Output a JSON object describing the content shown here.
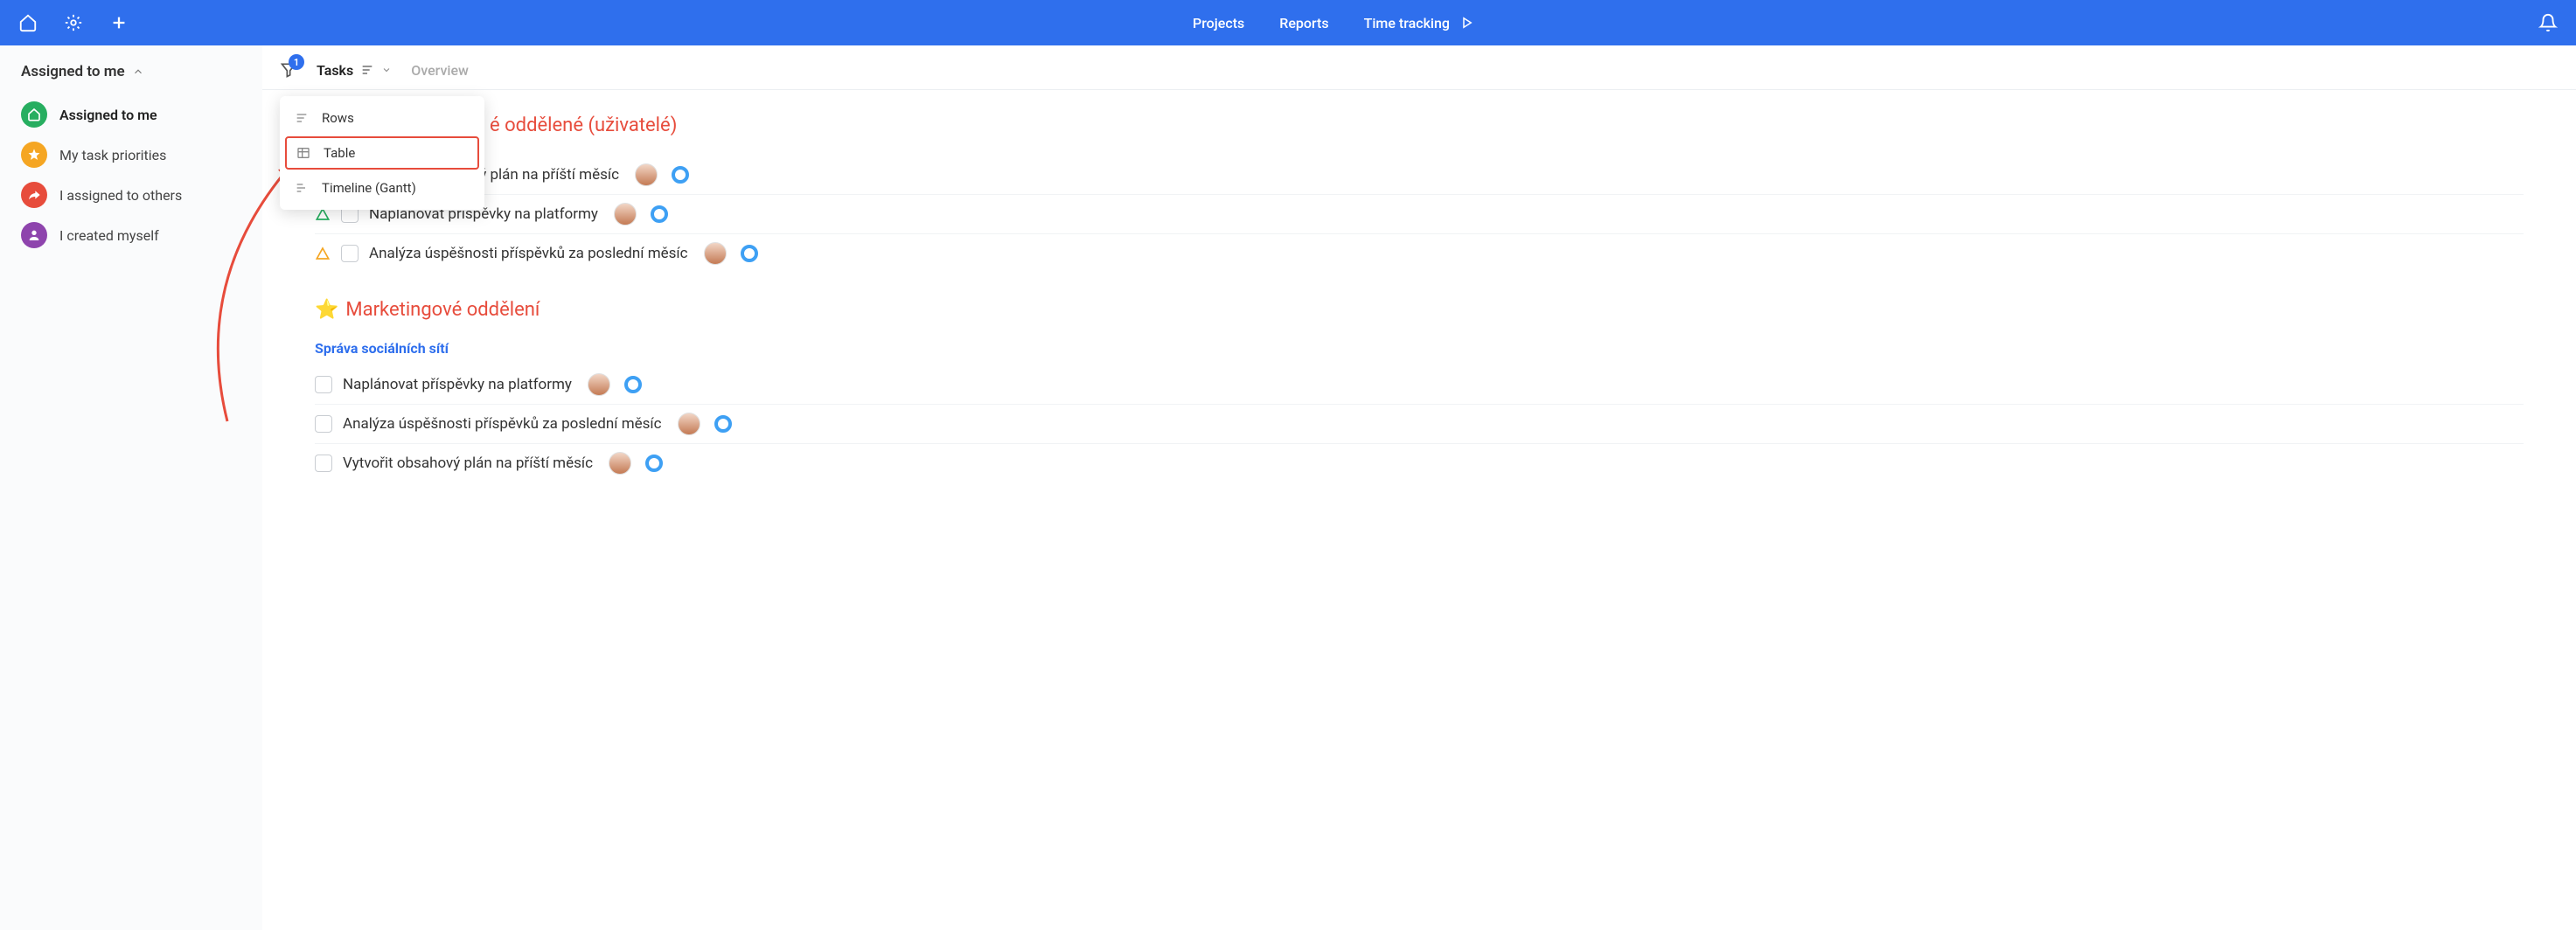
{
  "topbar": {
    "nav": {
      "projects": "Projects",
      "reports": "Reports",
      "timetracking": "Time tracking"
    }
  },
  "sidebar": {
    "title": "Assigned to me",
    "items": [
      {
        "label": "Assigned to me",
        "id": "assigned-to-me"
      },
      {
        "label": "My task priorities",
        "id": "my-task-priorities"
      },
      {
        "label": "I assigned to others",
        "id": "i-assigned-to-others"
      },
      {
        "label": "I created myself",
        "id": "i-created-myself"
      }
    ]
  },
  "tabbar": {
    "filter_badge": "1",
    "tasks_label": "Tasks",
    "overview_label": "Overview"
  },
  "dropdown": {
    "rows": "Rows",
    "table": "Table",
    "timeline": "Timeline (Gantt)"
  },
  "content": {
    "heading_partial": "é oddělené (uživatelé)",
    "section1_tasks": [
      {
        "title": "Vytvořit obsahový plán na příští měsíc",
        "priority": "green"
      },
      {
        "title": "Naplánovat příspěvky na platformy",
        "priority": "green"
      },
      {
        "title": "Analýza úspěšnosti příspěvků za poslední měsíc",
        "priority": "orange"
      }
    ],
    "section2_heading": "Marketingové oddělení",
    "section2_subheading": "Správa sociálních sítí",
    "section2_tasks": [
      {
        "title": "Naplánovat příspěvky na platformy"
      },
      {
        "title": "Analýza úspěšnosti příspěvků za poslední měsíc"
      },
      {
        "title": "Vytvořit obsahový plán na příští měsíc"
      }
    ]
  }
}
